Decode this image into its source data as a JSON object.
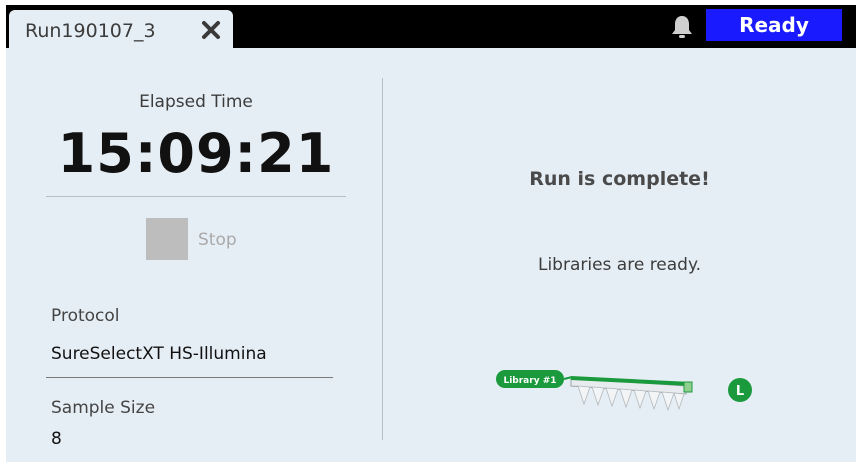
{
  "tab": {
    "title": "Run190107_3"
  },
  "header": {
    "status": "Ready",
    "colors": {
      "status_bg": "#1a1aff",
      "bar": "#000000"
    }
  },
  "left": {
    "elapsed_label": "Elapsed Time",
    "elapsed_value": "15:09:21",
    "stop_label": "Stop",
    "protocol_label": "Protocol",
    "protocol_value": "SureSelectXT HS-Illumina",
    "sample_size_label": "Sample Size",
    "sample_size_value": "8"
  },
  "right": {
    "message": "Run is complete!",
    "submessage": "Libraries are ready.",
    "library_tag": "Library #1",
    "location_badge": "L",
    "colors": {
      "accent": "#1a9a3c"
    }
  },
  "icons": {
    "close": "close-icon",
    "bell": "bell-icon"
  }
}
